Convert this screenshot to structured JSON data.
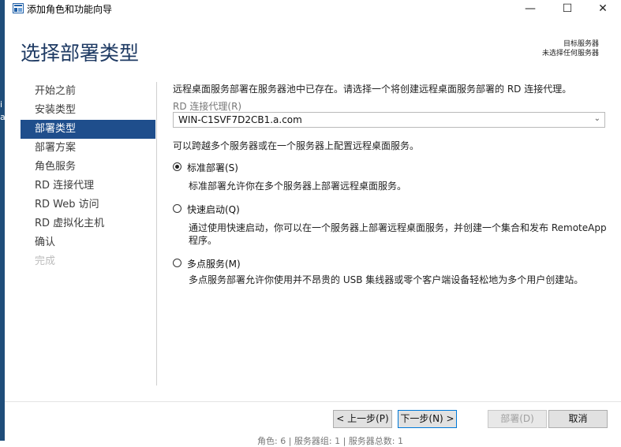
{
  "window": {
    "title": "添加角色和功能向导",
    "controls": {
      "minimize": "—",
      "maximize": "☐",
      "close": "✕"
    }
  },
  "page_title": "选择部署类型",
  "destination": {
    "label": "目标服务器",
    "value": "未选择任何服务器"
  },
  "nav": [
    {
      "label": "开始之前",
      "state": "normal"
    },
    {
      "label": "安装类型",
      "state": "normal"
    },
    {
      "label": "部署类型",
      "state": "active"
    },
    {
      "label": "部署方案",
      "state": "normal"
    },
    {
      "label": "角色服务",
      "state": "normal"
    },
    {
      "label": "RD 连接代理",
      "state": "normal"
    },
    {
      "label": "RD Web 访问",
      "state": "normal"
    },
    {
      "label": "RD 虚拟化主机",
      "state": "normal"
    },
    {
      "label": "确认",
      "state": "normal"
    },
    {
      "label": "完成",
      "state": "disabled"
    }
  ],
  "main": {
    "intro": "远程桌面服务部署在服务器池中已存在。请选择一个将创建远程桌面服务部署的 RD 连接代理。",
    "broker_label": "RD 连接代理(R)",
    "broker_value": "WIN-C1SVF7D2CB1.a.com",
    "hint": "可以跨越多个服务器或在一个服务器上配置远程桌面服务。",
    "options": [
      {
        "label": "标准部署(S)",
        "checked": true,
        "desc": "标准部署允许你在多个服务器上部署远程桌面服务。"
      },
      {
        "label": "快速启动(Q)",
        "checked": false,
        "desc": "通过使用快速启动，你可以在一个服务器上部署远程桌面服务，并创建一个集合和发布 RemoteApp 程序。"
      },
      {
        "label": "多点服务(M)",
        "checked": false,
        "desc": "多点服务部署允许你使用并不昂贵的 USB 集线器或零个客户端设备轻松地为多个用户创建站。"
      }
    ]
  },
  "buttons": {
    "prev": "< 上一步(P)",
    "next": "下一步(N) >",
    "deploy": "部署(D)",
    "cancel": "取消"
  },
  "background_text": "角色: 6 | 服务器组: 1 | 服务器总数: 1",
  "colors": {
    "accent": "#1f4e8c",
    "title": "#1e3a63"
  }
}
